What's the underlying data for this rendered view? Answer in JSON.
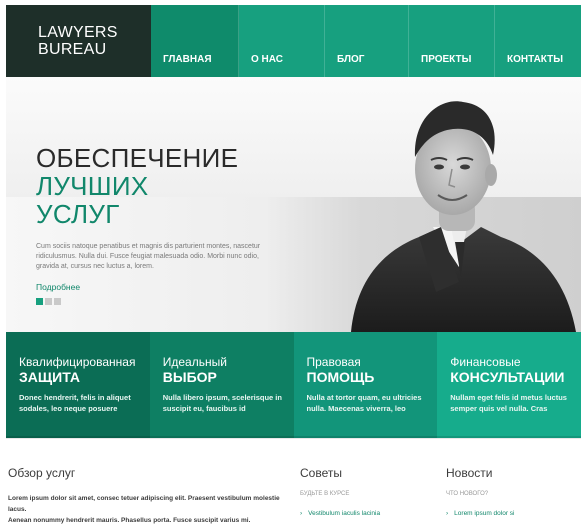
{
  "logo": {
    "line1": "LAWYERS",
    "line2": "BUREAU"
  },
  "nav": [
    {
      "label": "ГЛАВНАЯ"
    },
    {
      "label": "О НАС"
    },
    {
      "label": "БЛОГ"
    },
    {
      "label": "ПРОЕКТЫ"
    },
    {
      "label": "КОНТАКТЫ"
    }
  ],
  "hero": {
    "title1": "ОБЕСПЕЧЕНИЕ",
    "title2": "ЛУЧШИХ",
    "title3": "УСЛУГ",
    "text": "Cum sociis natoque penatibus et magnis dis parturient montes, nascetur ridiculusmus. Nulla dui. Fusce feugiat malesuada odio. Morbi nunc odio, gravida at, cursus nec luctus a, lorem.",
    "more": "Подробнее"
  },
  "features": [
    {
      "top": "Квалифицированная",
      "big": "ЗАЩИТА",
      "text": "Donec hendrerit, felis in aliquet sodales, leo neque posuere"
    },
    {
      "top": "Идеальный",
      "big": "ВЫБОР",
      "text": "Nulla libero ipsum, scelerisque in suscipit eu, faucibus id"
    },
    {
      "top": "Правовая",
      "big": "ПОМОЩЬ",
      "text": "Nulla at tortor quam, eu ultricies nulla. Maecenas viverra, leo"
    },
    {
      "top": "Финансовые",
      "big": "КОНСУЛЬТАЦИИ",
      "text": "Nullam eget felis id metus luctus semper quis vel nulla. Cras"
    }
  ],
  "services": {
    "heading": "Обзор услуг",
    "text1": "Lorem ipsum dolor sit amet, consec tetuer adipiscing elit. Praesent vestibulum molestie lacus.",
    "text2": "Aenean nonummy hendrerit mauris. Phasellus porta. Fusce suscipit varius mi."
  },
  "tips": {
    "heading": "Советы",
    "sub": "БУДЬТЕ В КУРСЕ",
    "link": "Vestibulum iaculis lacinia"
  },
  "news": {
    "heading": "Новости",
    "sub": "ЧТО НОВОГО?",
    "link": "Lorem ipsum dolor si"
  },
  "colors": {
    "accent": "#17a07f",
    "dark": "#1e2f29",
    "green_text": "#11876b"
  }
}
